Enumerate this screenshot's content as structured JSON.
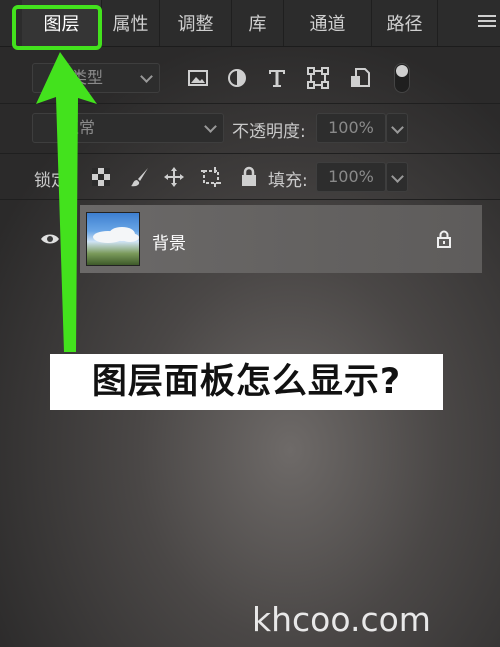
{
  "tabs": [
    {
      "label": "图层",
      "active": true
    },
    {
      "label": "属性",
      "active": false
    },
    {
      "label": "调整",
      "active": false
    },
    {
      "label": "库",
      "active": false
    },
    {
      "label": "通道",
      "active": false
    },
    {
      "label": "路径",
      "active": false
    }
  ],
  "filter": {
    "type_value": "类型"
  },
  "filter_icons": [
    "image-filter-icon",
    "adjustment-filter-icon",
    "text-filter-icon",
    "shape-filter-icon",
    "smart-object-filter-icon"
  ],
  "blend": {
    "mode_value": "正常"
  },
  "opacity": {
    "label": "不透明度:",
    "value": "100%"
  },
  "lock": {
    "label": "锁定:"
  },
  "fill": {
    "label": "填充:",
    "value": "100%"
  },
  "layers": [
    {
      "name": "背景",
      "visible": true,
      "locked": true
    }
  ],
  "annotation": {
    "banner_text": "图层面板怎么显示?",
    "highlight_color": "#43e21d"
  },
  "watermark": "khcoo.com"
}
